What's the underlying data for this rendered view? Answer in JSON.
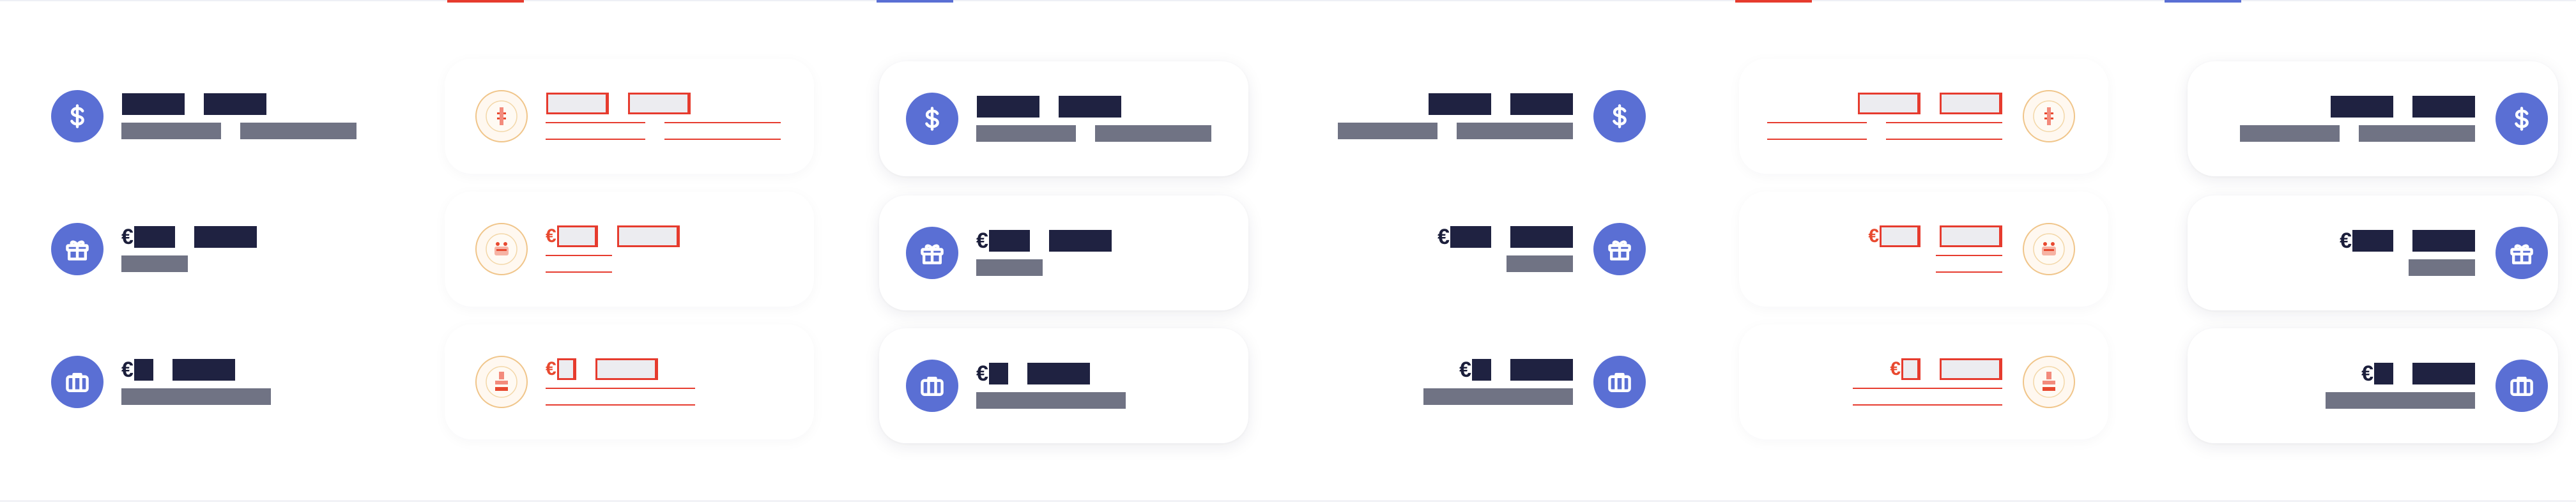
{
  "screen": {
    "description_free_note": ""
  },
  "panels": [
    {
      "variant": "plain-ltr",
      "accent": "#5a6fd4",
      "items": [
        {
          "icon": "dollar-icon",
          "currency": "",
          "amount": "",
          "detail": ""
        },
        {
          "icon": "gift-icon",
          "currency": "€",
          "amount": "",
          "detail": ""
        },
        {
          "icon": "briefcase-icon",
          "currency": "€",
          "amount": "",
          "detail": ""
        }
      ]
    },
    {
      "variant": "debug-ltr",
      "accent": "#e63b2e",
      "items": [
        {
          "icon": "flag-badge-icon",
          "currency": "",
          "amount": "",
          "detail": ""
        },
        {
          "icon": "flag-badge-icon",
          "currency": "€",
          "amount": "",
          "detail": ""
        },
        {
          "icon": "flag-badge-icon",
          "currency": "€",
          "amount": "",
          "detail": ""
        }
      ]
    },
    {
      "variant": "carded-ltr",
      "accent": "#5a6fd4",
      "items": [
        {
          "icon": "dollar-icon",
          "currency": "",
          "amount": "",
          "detail": ""
        },
        {
          "icon": "gift-icon",
          "currency": "€",
          "amount": "",
          "detail": ""
        },
        {
          "icon": "briefcase-icon",
          "currency": "€",
          "amount": "",
          "detail": ""
        }
      ]
    },
    {
      "variant": "plain-rtl",
      "accent": "#5a6fd4",
      "items": [
        {
          "icon": "dollar-icon",
          "currency": "",
          "amount": "",
          "detail": ""
        },
        {
          "icon": "gift-icon",
          "currency": "€",
          "amount": "",
          "detail": ""
        },
        {
          "icon": "briefcase-icon",
          "currency": "€",
          "amount": "",
          "detail": ""
        }
      ]
    },
    {
      "variant": "debug-rtl",
      "accent": "#e63b2e",
      "items": [
        {
          "icon": "flag-badge-icon",
          "currency": "",
          "amount": "",
          "detail": ""
        },
        {
          "icon": "flag-badge-icon",
          "currency": "€",
          "amount": "",
          "detail": ""
        },
        {
          "icon": "flag-badge-icon",
          "currency": "€",
          "amount": "",
          "detail": ""
        }
      ]
    },
    {
      "variant": "carded-rtl",
      "accent": "#5a6fd4",
      "items": [
        {
          "icon": "dollar-icon",
          "currency": "",
          "amount": "",
          "detail": ""
        },
        {
          "icon": "gift-icon",
          "currency": "€",
          "amount": "",
          "detail": ""
        },
        {
          "icon": "briefcase-icon",
          "currency": "€",
          "amount": "",
          "detail": ""
        }
      ]
    }
  ],
  "colors": {
    "icon_bg": "#5a6fd4",
    "redacted_primary": "#1f2241",
    "redacted_secondary": "#707384",
    "debug_outline": "#e63b2e",
    "badge_ring": "#f0c58a"
  }
}
